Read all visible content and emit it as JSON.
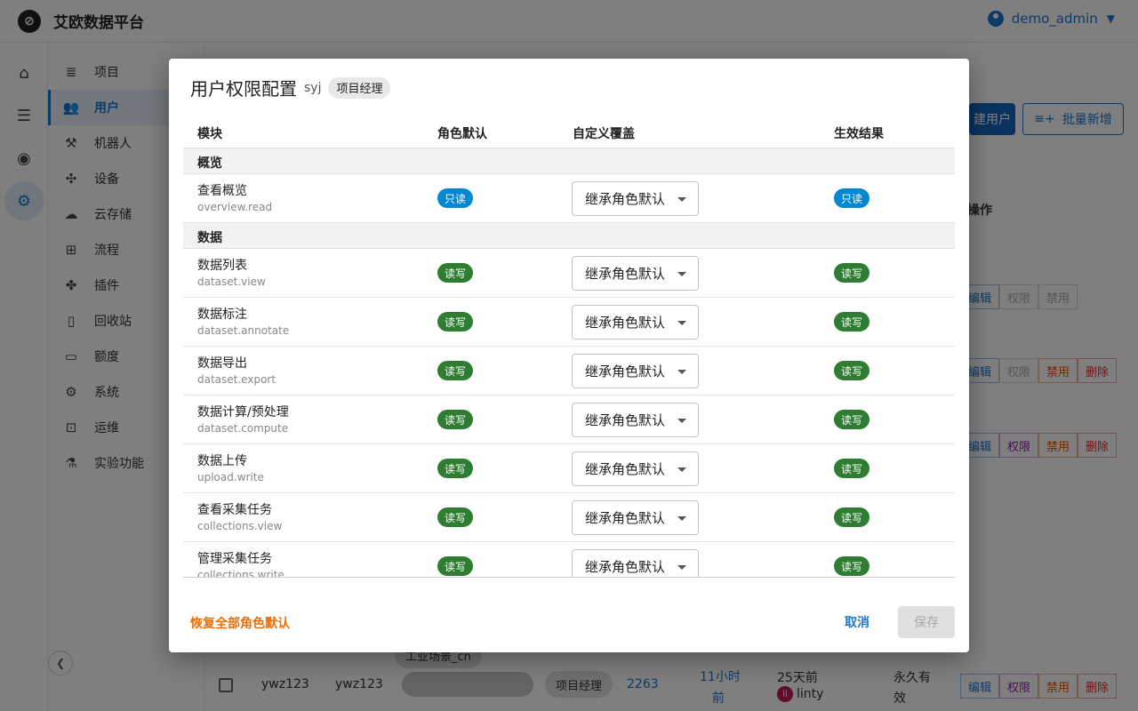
{
  "app": {
    "title": "艾欧数据平台",
    "user": "demo_admin"
  },
  "sidebar": {
    "items": [
      {
        "label": "项目",
        "icon": "list-icon"
      },
      {
        "label": "用户",
        "icon": "users-icon",
        "active": true
      },
      {
        "label": "机器人",
        "icon": "robot-arm-icon"
      },
      {
        "label": "设备",
        "icon": "device-network-icon"
      },
      {
        "label": "云存储",
        "icon": "cloud-icon"
      },
      {
        "label": "流程",
        "icon": "flow-icon"
      },
      {
        "label": "插件",
        "icon": "puzzle-icon"
      },
      {
        "label": "回收站",
        "icon": "trash-icon"
      },
      {
        "label": "额度",
        "icon": "credit-card-icon"
      },
      {
        "label": "系统",
        "icon": "gear-icon"
      },
      {
        "label": "运维",
        "icon": "monitor-icon"
      },
      {
        "label": "实验功能",
        "icon": "flask-icon"
      }
    ]
  },
  "background": {
    "create_user_label": "建用户",
    "batch_add_label": "批量新增",
    "ops_header": "操作",
    "actions": {
      "edit": "编辑",
      "perm": "权限",
      "ban": "禁用",
      "del": "删除"
    },
    "scene_chip": "工业场景_cn",
    "last_row": {
      "username": "ywz123",
      "name": "ywz123",
      "role": "项目经理",
      "count": "2263",
      "time_line1": "11小时",
      "time_line2": "前",
      "updated": "25天前",
      "creator_initial": "li",
      "creator": "linty",
      "validity_line1": "永久有",
      "validity_line2": "效"
    }
  },
  "dialog": {
    "title": "用户权限配置",
    "user": "syj",
    "role": "项目经理",
    "columns": {
      "module": "模块",
      "role_default": "角色默认",
      "override": "自定义覆盖",
      "result": "生效结果"
    },
    "groups": [
      {
        "name": "概览",
        "rows": [
          {
            "name": "查看概览",
            "key": "overview.read",
            "role_default": "只读",
            "override": "继承角色默认",
            "result": "只读"
          }
        ]
      },
      {
        "name": "数据",
        "rows": [
          {
            "name": "数据列表",
            "key": "dataset.view",
            "role_default": "读写",
            "override": "继承角色默认",
            "result": "读写"
          },
          {
            "name": "数据标注",
            "key": "dataset.annotate",
            "role_default": "读写",
            "override": "继承角色默认",
            "result": "读写"
          },
          {
            "name": "数据导出",
            "key": "dataset.export",
            "role_default": "读写",
            "override": "继承角色默认",
            "result": "读写"
          },
          {
            "name": "数据计算/预处理",
            "key": "dataset.compute",
            "role_default": "读写",
            "override": "继承角色默认",
            "result": "读写"
          },
          {
            "name": "数据上传",
            "key": "upload.write",
            "role_default": "读写",
            "override": "继承角色默认",
            "result": "读写"
          },
          {
            "name": "查看采集任务",
            "key": "collections.view",
            "role_default": "读写",
            "override": "继承角色默认",
            "result": "读写"
          },
          {
            "name": "管理采集任务",
            "key": "collections.write",
            "role_default": "读写",
            "override": "继承角色默认",
            "result": "读写"
          }
        ]
      }
    ],
    "reset_label": "恢复全部角色默认",
    "cancel_label": "取消",
    "save_label": "保存"
  },
  "colors": {
    "accent": "#1976d2",
    "read_only": "#0288d1",
    "read_write": "#2e7d32",
    "reset": "#ef6c00"
  }
}
